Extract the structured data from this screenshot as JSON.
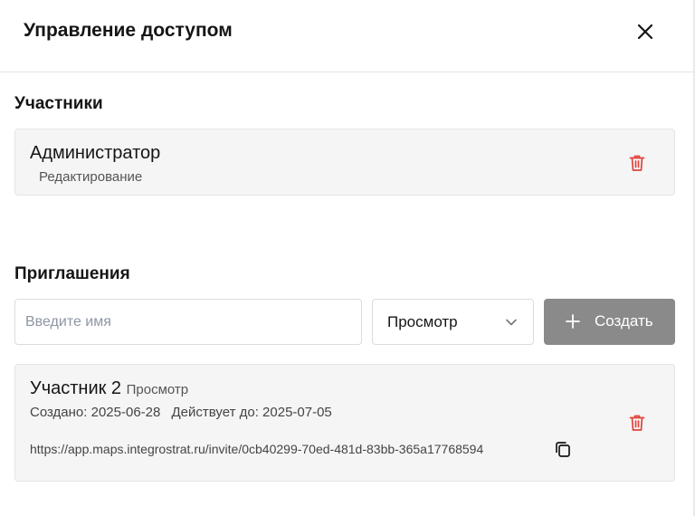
{
  "dialog": {
    "title": "Управление доступом",
    "close_icon": "close-icon"
  },
  "members": {
    "section_title": "Участники",
    "items": [
      {
        "name": "Администратор",
        "role": "Редактирование",
        "delete_icon": "trash-icon"
      }
    ]
  },
  "invitations": {
    "section_title": "Приглашения",
    "name_input": {
      "value": "",
      "placeholder": "Введите имя"
    },
    "role_select": {
      "selected": "Просмотр",
      "icon": "chevron-down-icon"
    },
    "create_button": {
      "label": "Создать",
      "icon": "plus-icon"
    },
    "items": [
      {
        "name": "Участник 2",
        "role": "Просмотр",
        "created": "Создано: 2025-06-28",
        "expires": "Действует до: 2025-07-05",
        "url": "https://app.maps.integrostrat.ru/invite/0cb40299-70ed-481d-83bb-365a17768594",
        "copy_icon": "copy-icon",
        "delete_icon": "trash-icon"
      }
    ]
  },
  "colors": {
    "danger": "#e0443d",
    "button_disabled": "#8a8a8a",
    "card_bg": "#f5f5f5"
  }
}
